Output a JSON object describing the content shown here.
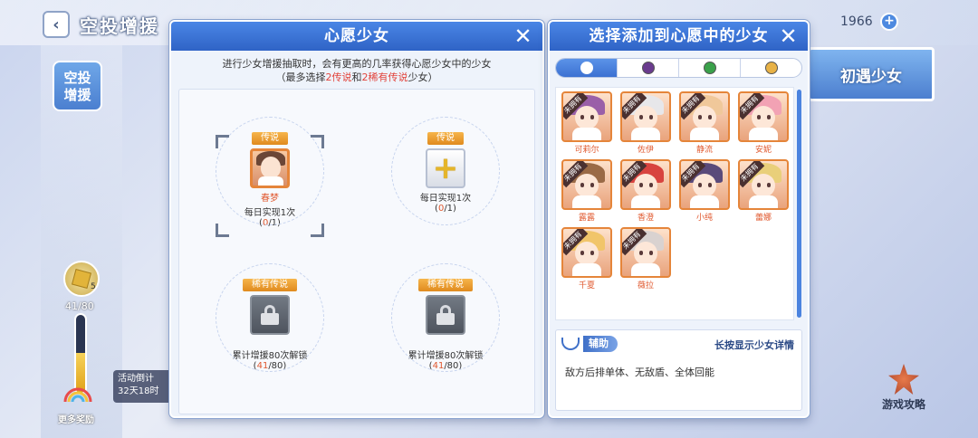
{
  "topbar": {
    "title": "空投增援",
    "currency": "1966"
  },
  "sidebar": {
    "tab_label": "空投\n增援",
    "token_count": "5",
    "progress_text": "41/80",
    "progress_fraction": 0.5125,
    "more_rewards": "更多奖励",
    "event_tip_line1": "活动倒计",
    "event_tip_line2": "32天18时"
  },
  "meet_button": "初遇少女",
  "guide_label": "游戏攻略",
  "wish_panel": {
    "title": "心愿少女",
    "desc_line1": "进行少女增援抽取时，会有更高的几率获得心愿少女中的少女",
    "desc_prefix": "（最多选择",
    "desc_count1": "2传说",
    "desc_mid": "和",
    "desc_count2": "2稀有传说",
    "desc_suffix": "少女）",
    "slots": [
      {
        "tag": "传说",
        "name": "春梦",
        "line": "每日实现1次",
        "cnt_open": "(",
        "cnt_cur": "0",
        "cnt_rest": "/1)"
      },
      {
        "tag": "传说",
        "name": "",
        "line": "每日实现1次",
        "cnt_open": "(",
        "cnt_cur": "0",
        "cnt_rest": "/1)"
      },
      {
        "tag": "稀有传说",
        "name": "",
        "line": "累计增援80次解锁",
        "cnt_open": "(",
        "cnt_cur": "41",
        "cnt_rest": "/80)"
      },
      {
        "tag": "稀有传说",
        "name": "",
        "line": "累计增援80次解锁",
        "cnt_open": "(",
        "cnt_cur": "41",
        "cnt_rest": "/80)"
      }
    ]
  },
  "select_panel": {
    "title": "选择添加到心愿中的少女",
    "ribbon": "未拥有",
    "characters": [
      {
        "name": "可莉尔",
        "hair": "#9a5fa8"
      },
      {
        "name": "佐伊",
        "hair": "#e7e7ea"
      },
      {
        "name": "静流",
        "hair": "#f0c89a"
      },
      {
        "name": "安妮",
        "hair": "#f2a2b4"
      },
      {
        "name": "露露",
        "hair": "#9a6a46"
      },
      {
        "name": "香澄",
        "hair": "#d8433f"
      },
      {
        "name": "小纯",
        "hair": "#5a4a7a"
      },
      {
        "name": "蕾娜",
        "hair": "#e9cf7a"
      },
      {
        "name": "千夏",
        "hair": "#f1c56a"
      },
      {
        "name": "薇拉",
        "hair": "#d9d2d0"
      }
    ],
    "role_label": "辅助",
    "hold_hint": "长按显示少女详情",
    "role_desc": "敌方后排单体、无敌盾、全体回能"
  }
}
